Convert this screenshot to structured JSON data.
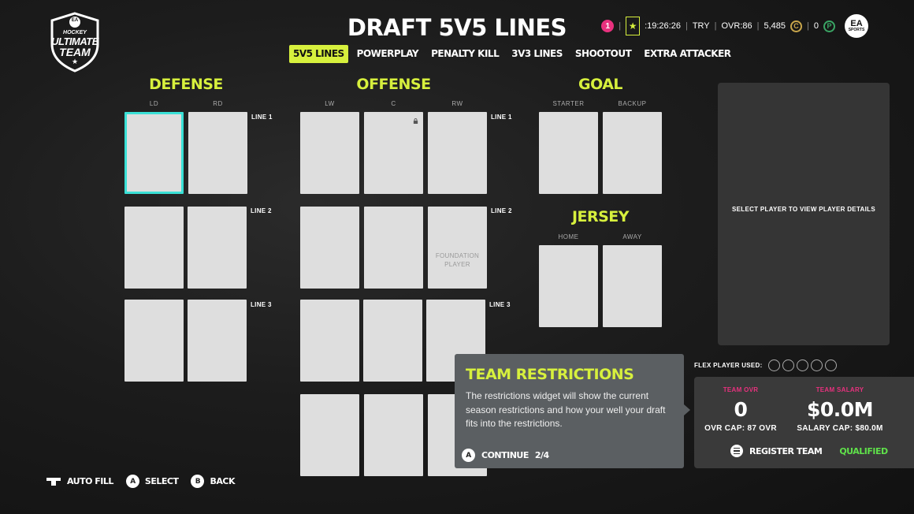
{
  "header": {
    "title": "DRAFT 5V5 LINES",
    "logo_text": {
      "ea": "EA",
      "hockey": "HOCKEY",
      "ultimate": "ULTIMATE",
      "team": "TEAM"
    }
  },
  "tabs": [
    {
      "label": "5V5 LINES",
      "active": true
    },
    {
      "label": "POWERPLAY",
      "active": false
    },
    {
      "label": "PENALTY KILL",
      "active": false
    },
    {
      "label": "3V3 LINES",
      "active": false
    },
    {
      "label": "SHOOTOUT",
      "active": false
    },
    {
      "label": "EXTRA ATTACKER",
      "active": false
    }
  ],
  "status": {
    "notifications": "1",
    "timer": ":19:26:26",
    "region": "TRY",
    "ovr": "OVR:86",
    "coins": "5,485",
    "points": "0",
    "ea_logo": "EA",
    "ea_sub": "SPORTS"
  },
  "defense": {
    "heading": "DEFENSE",
    "columns": [
      "LD",
      "RD"
    ],
    "lines": [
      "LINE 1",
      "LINE 2",
      "LINE 3"
    ]
  },
  "offense": {
    "heading": "OFFENSE",
    "columns": [
      "LW",
      "C",
      "RW"
    ],
    "lines": [
      "LINE 1",
      "LINE 2",
      "LINE 3"
    ],
    "foundation_label": "FOUNDATION PLAYER"
  },
  "goal": {
    "heading": "GOAL",
    "columns": [
      "STARTER",
      "BACKUP"
    ]
  },
  "jersey": {
    "heading": "JERSEY",
    "columns": [
      "HOME",
      "AWAY"
    ]
  },
  "details": {
    "text": "SELECT PLAYER TO VIEW PLAYER DETAILS"
  },
  "flex": {
    "label": "FLEX PLAYER USED:"
  },
  "summary": {
    "team_ovr_label": "TEAM OVR",
    "team_ovr_value": "0",
    "ovr_cap": "OVR CAP: 87 OVR",
    "team_salary_label": "TEAM SALARY",
    "team_salary_value": "$0.0M",
    "salary_cap": "SALARY CAP: $80.0M",
    "register_label": "REGISTER TEAM",
    "qualified": "QUALIFIED"
  },
  "tooltip": {
    "title": "TEAM RESTRICTIONS",
    "body": "The restrictions widget will show the current season restrictions and how your well your draft fits into the restrictions.",
    "button_key": "A",
    "continue_label": "CONTINUE",
    "step": "2/4"
  },
  "controls": {
    "autofill": "AUTO FILL",
    "select_key": "A",
    "select": "SELECT",
    "back_key": "B",
    "back": "BACK"
  },
  "colors": {
    "accent": "#d7f03d",
    "selected": "#3ae0d6",
    "pink": "#e8317e",
    "qualified": "#5fe04a"
  }
}
